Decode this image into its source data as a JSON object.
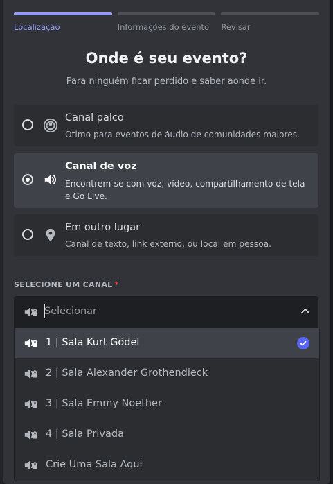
{
  "steps": [
    {
      "label": "Localização",
      "active": true
    },
    {
      "label": "Informações do evento",
      "active": false
    },
    {
      "label": "Revisar",
      "active": false
    }
  ],
  "title": "Onde é seu evento?",
  "subtitle": "Para ninguém ficar perdido e saber aonde ir.",
  "options": [
    {
      "title": "Canal palco",
      "description": "Ótimo para eventos de áudio de comunidades maiores.",
      "icon": "stage-icon",
      "selected": false
    },
    {
      "title": "Canal de voz",
      "description": "Encontrem-se com voz, vídeo, compartilhamento de tela e Go Live.",
      "icon": "speaker-icon",
      "selected": true
    },
    {
      "title": "Em outro lugar",
      "description": "Canal de texto, link externo, ou local em pessoa.",
      "icon": "location-pin-icon",
      "selected": false
    }
  ],
  "channel_select": {
    "label": "SELECIONE UM CANAL",
    "required_mark": "*",
    "placeholder": "Selecionar",
    "items": [
      {
        "label": "1 | Sala Kurt Gödel",
        "selected": true
      },
      {
        "label": "2 | Sala Alexander Grothendieck",
        "selected": false
      },
      {
        "label": "3 | Sala Emmy Noether",
        "selected": false
      },
      {
        "label": "4 | Sala Privada",
        "selected": false
      },
      {
        "label": "Crie Uma Sala Aqui",
        "selected": false
      }
    ]
  },
  "colors": {
    "accent": "#5865f2",
    "progress_active": "#949cf7",
    "required": "#f23f43"
  }
}
